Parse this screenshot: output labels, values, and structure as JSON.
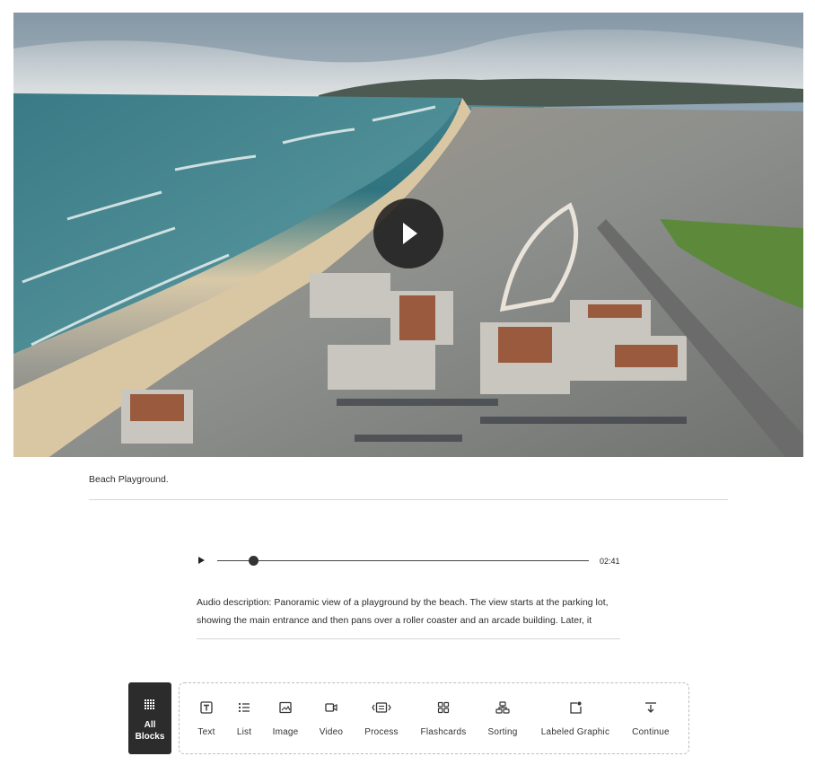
{
  "video": {
    "play_label": "Play"
  },
  "caption": "Beach Playground.",
  "audio": {
    "time": "02:41",
    "progress": 0.09,
    "description": "Audio description: Panoramic view of a playground by the beach. The view starts at the parking lot, showing the main entrance and then pans over a roller coaster and an arcade building. Later, it moves"
  },
  "toolbar": {
    "all_blocks_line1": "All",
    "all_blocks_line2": "Blocks",
    "blocks": [
      {
        "label": "Text",
        "icon": "text-icon"
      },
      {
        "label": "List",
        "icon": "list-icon"
      },
      {
        "label": "Image",
        "icon": "image-icon"
      },
      {
        "label": "Video",
        "icon": "video-icon"
      },
      {
        "label": "Process",
        "icon": "process-icon"
      },
      {
        "label": "Flashcards",
        "icon": "flashcards-icon"
      },
      {
        "label": "Sorting",
        "icon": "sorting-icon"
      },
      {
        "label": "Labeled Graphic",
        "icon": "labeled-graphic-icon"
      },
      {
        "label": "Continue",
        "icon": "continue-icon"
      }
    ]
  }
}
